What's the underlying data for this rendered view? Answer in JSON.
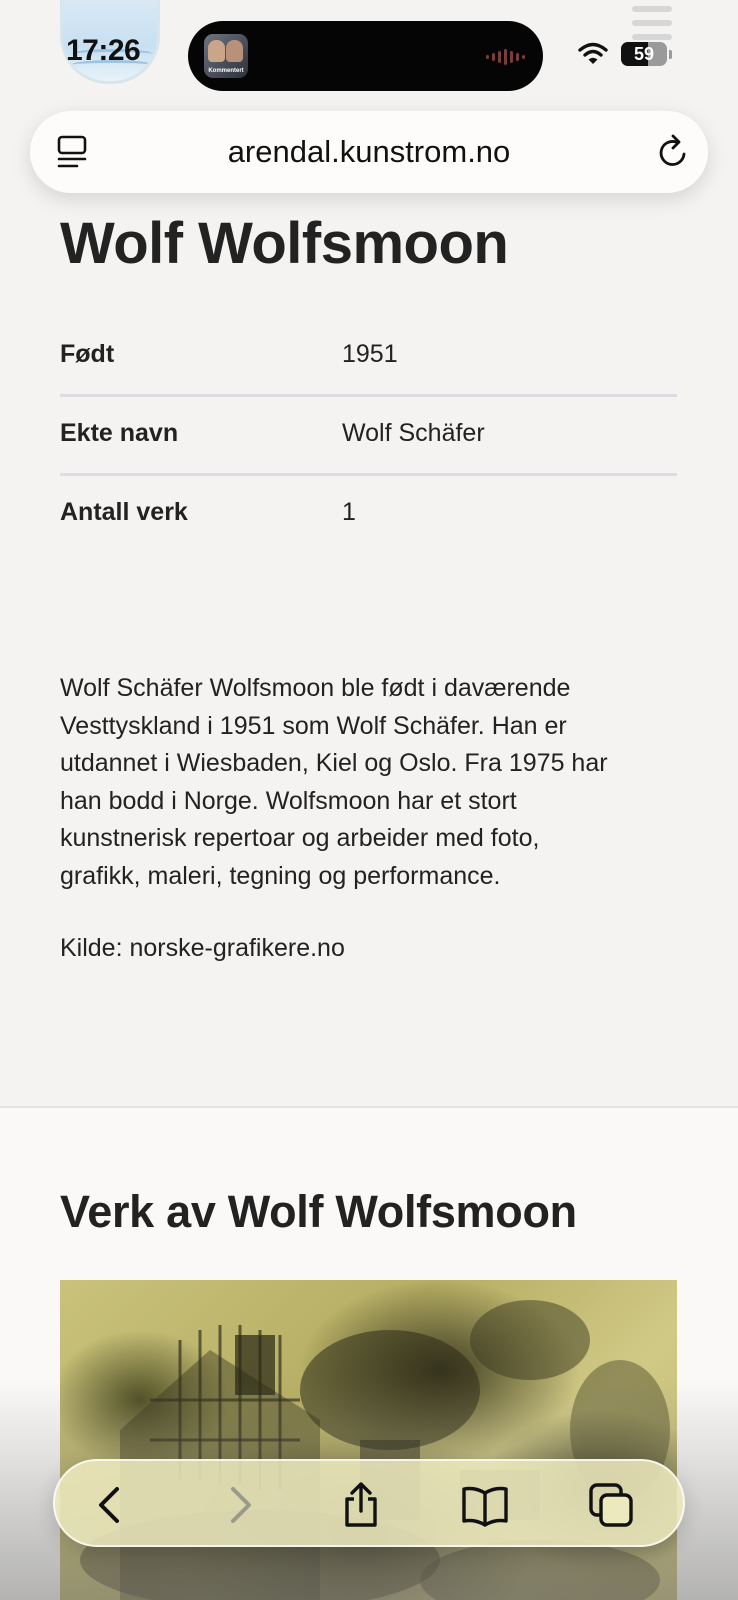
{
  "status_bar": {
    "time": "17:26",
    "island_thumbnail_label": "Kommentert",
    "battery_percent": "59",
    "battery_level": 0.59,
    "icons": [
      "site-crest-icon",
      "wifi-icon",
      "battery-icon",
      "audio-waveform-icon"
    ]
  },
  "browser": {
    "url": "arendal.kunstrom.no",
    "icons": [
      "reader-mode-icon",
      "reload-icon"
    ]
  },
  "artist": {
    "name": "Wolf Wolfsmoon",
    "facts": [
      {
        "label": "Født",
        "value": "1951"
      },
      {
        "label": "Ekte navn",
        "value": "Wolf Schäfer"
      },
      {
        "label": "Antall verk",
        "value": "1"
      }
    ],
    "bio_lines": [
      "Wolf Schäfer Wolfsmoon ble født i daværende",
      "Vesttyskland i 1951 som Wolf Schäfer. Han er",
      "utdannet i Wiesbaden, Kiel og Oslo. Fra 1975 har",
      "han bodd i Norge. Wolfsmoon har et stort",
      "kunstnerisk repertoar og arbeider med foto,",
      "grafikk, maleri, tegning og performance."
    ],
    "source": "Kilde: norske-grafikere.no"
  },
  "works": {
    "heading": "Verk av Wolf Wolfsmoon"
  },
  "toolbar": {
    "buttons": [
      "back-icon",
      "forward-icon",
      "share-icon",
      "bookmarks-icon",
      "tabs-icon"
    ]
  },
  "colors": {
    "page_bg": "#f5f3f1",
    "text": "#222222",
    "divider": "#dddce5",
    "toolbar_tint": "#ece9be"
  }
}
